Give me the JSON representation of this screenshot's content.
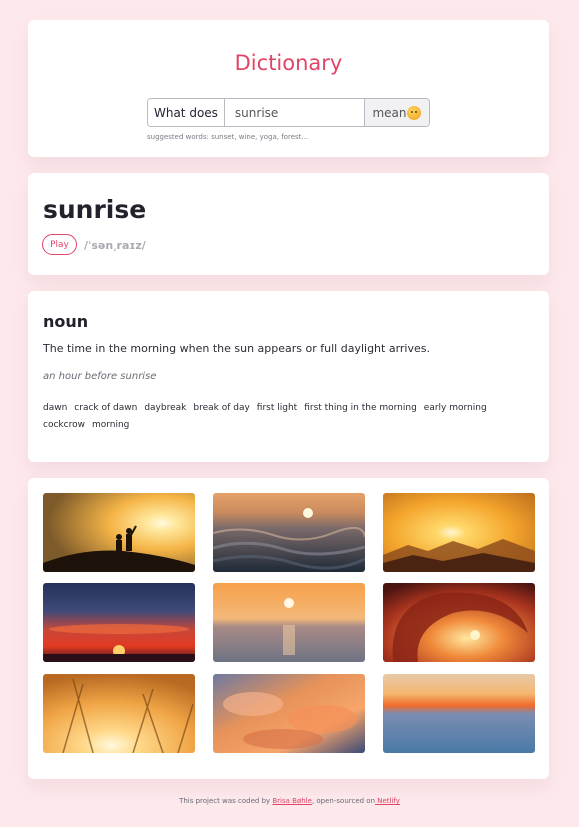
{
  "app": {
    "title": "Dictionary"
  },
  "search": {
    "prefix": "What does",
    "value": "sunrise",
    "button_label": "mean",
    "button_icon": "thinking-face-emoji-icon",
    "suggestions": "suggested words: sunset, wine, yoga, forest..."
  },
  "word": {
    "text": "sunrise",
    "play_label": "Play",
    "phonetic": "/ˈsən͵raɪz/"
  },
  "meaning": {
    "part_of_speech": "noun",
    "definition": "The time in the morning when the sun appears or full daylight arrives.",
    "example": "an hour before sunrise",
    "synonyms": [
      "dawn",
      "crack of dawn",
      "daybreak",
      "break of day",
      "first light",
      "first thing in the morning",
      "early morning",
      "cockcrow",
      "morning"
    ]
  },
  "photos": [
    "sunrise-photo-couple-silhouette",
    "sunrise-photo-ocean-waves",
    "sunrise-photo-mountains",
    "sunrise-photo-red-sky-clouds",
    "sunrise-photo-calm-sea",
    "sunrise-photo-wave-curl",
    "sunrise-photo-grass",
    "sunrise-photo-orange-clouds",
    "sunrise-photo-horizon-blue"
  ],
  "footer": {
    "text_before": "This project was coded by ",
    "author": "Brisa Bøhle",
    "text_middle": ", open-sourced on",
    "host": " Netlify"
  },
  "colors": {
    "accent": "#e04467",
    "background": "#fde9ec"
  }
}
